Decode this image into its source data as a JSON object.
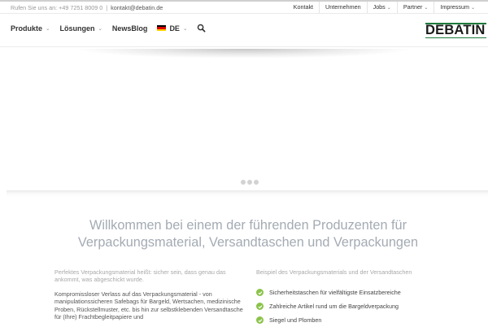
{
  "topbar": {
    "contact_prefix": "Rufen Sie uns an: +49 7251 8009 0",
    "separator": "|",
    "email": "kontakt@debatin.de",
    "links": [
      {
        "label": "Kontakt",
        "has_dropdown": false
      },
      {
        "label": "Unternehmen",
        "has_dropdown": false
      },
      {
        "label": "Jobs",
        "has_dropdown": true
      },
      {
        "label": "Partner",
        "has_dropdown": true
      },
      {
        "label": "Impressum",
        "has_dropdown": true
      }
    ]
  },
  "nav": {
    "items": [
      {
        "label": "Produkte",
        "has_dropdown": true
      },
      {
        "label": "Lösungen",
        "has_dropdown": true
      },
      {
        "label": "NewsBlog",
        "has_dropdown": false
      }
    ],
    "language": "DE",
    "search_icon": "search-icon"
  },
  "logo": {
    "text": "DEBATIN",
    "brand_color": "#1d7a3c"
  },
  "slider": {
    "dot_count": 3
  },
  "welcome": {
    "line1": "Willkommen bei einem der führenden Produzenten für",
    "line2": "Verpackungsmaterial, Versandtaschen und Verpackungen"
  },
  "left": {
    "intro": "Perfektes Verpackungsmaterial heißt: sicher sein, dass genau das ankommt, was abgeschickt wurde.",
    "body": "Kompromissloser Verlass auf das Verpackungsmaterial - von manipulationssicheren Safebags für Bargeld, Wertsachen, medizinische Proben, Rückstellmuster, etc. bis hin zur selbstklebenden Versandtasche für (Ihre) Frachtbegleitpapiere und"
  },
  "right": {
    "title": "Beispiel des Verpackungsmaterials und der Versandtaschen",
    "features": [
      "Sicherheitstaschen für vielfältigste Einsatzbereiche",
      "Zahlreiche Artikel rund um die Bargeldverpackung",
      "Siegel und Plomben"
    ],
    "check_color": "#8bc34a"
  }
}
